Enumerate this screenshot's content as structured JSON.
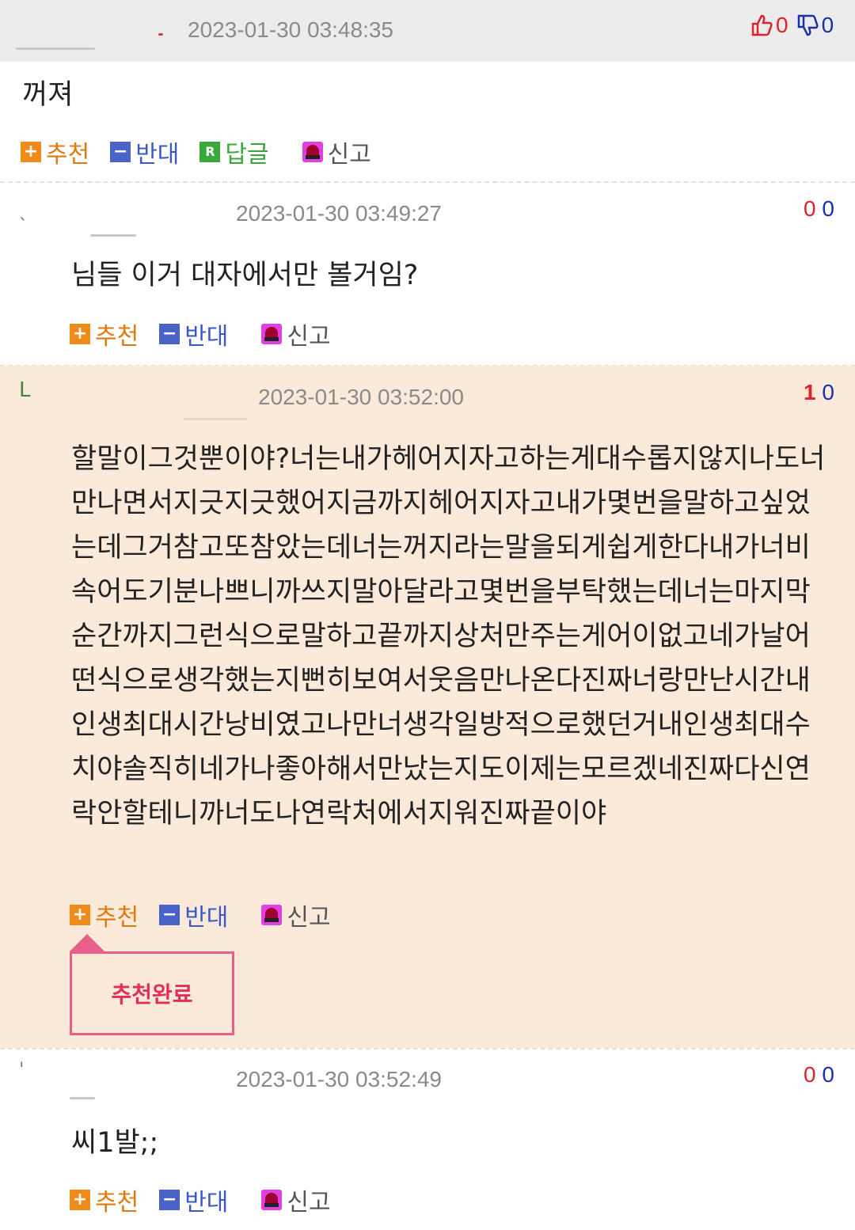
{
  "comments": [
    {
      "timestamp": "2023-01-30 03:48:35",
      "up": "0",
      "down": "0",
      "body": "꺼져",
      "actions": {
        "recommend": "추천",
        "oppose": "반대",
        "reply": "답글",
        "report": "신고"
      }
    },
    {
      "timestamp": "2023-01-30 03:49:27",
      "up": "0",
      "down": "0",
      "body": "님들 이거 대자에서만 볼거임?",
      "actions": {
        "recommend": "추천",
        "oppose": "반대",
        "report": "신고"
      }
    },
    {
      "timestamp": "2023-01-30 03:52:00",
      "up": "1",
      "down": "0",
      "body": "할말이그것뿐이야?너는내가헤어지자고하는게대수롭지않지나도너만나면서지긋지긋했어지금까지헤어지자고내가몇번을말하고싶었는데그거참고또참았는데너는꺼지라는말을되게쉽게한다내가너비속어도기분나쁘니까쓰지말아달라고몇번을부탁했는데너는마지막순간까지그런식으로말하고끝까지상처만주는게어이없고네가날어떤식으로생각했는지뻔히보여서웃음만나온다진짜너랑만난시간내인생최대시간낭비였고나만너생각일방적으로했던거내인생최대수치야솔직히네가나좋아해서만났는지도이제는모르겠네진짜다신연락안할테니까너도나연락처에서지워진짜끝이야",
      "actions": {
        "recommend": "추천",
        "oppose": "반대",
        "report": "신고"
      },
      "popup": "추천완료"
    },
    {
      "timestamp": "2023-01-30 03:52:49",
      "up": "0",
      "down": "0",
      "body": "씨1발;;",
      "actions": {
        "recommend": "추천",
        "oppose": "반대",
        "report": "신고"
      }
    }
  ],
  "icons": {
    "thumb_up": "thumbs-up-icon",
    "thumb_down": "thumbs-down-icon",
    "plus": "plus-icon",
    "minus": "minus-icon",
    "reply": "reply-icon",
    "report": "siren-icon"
  },
  "colors": {
    "up": "#e0202a",
    "down": "#1a2fa8",
    "highlight_bg": "#fbe9d9",
    "header_bg": "#ececec",
    "popup_border": "#e8608a"
  }
}
